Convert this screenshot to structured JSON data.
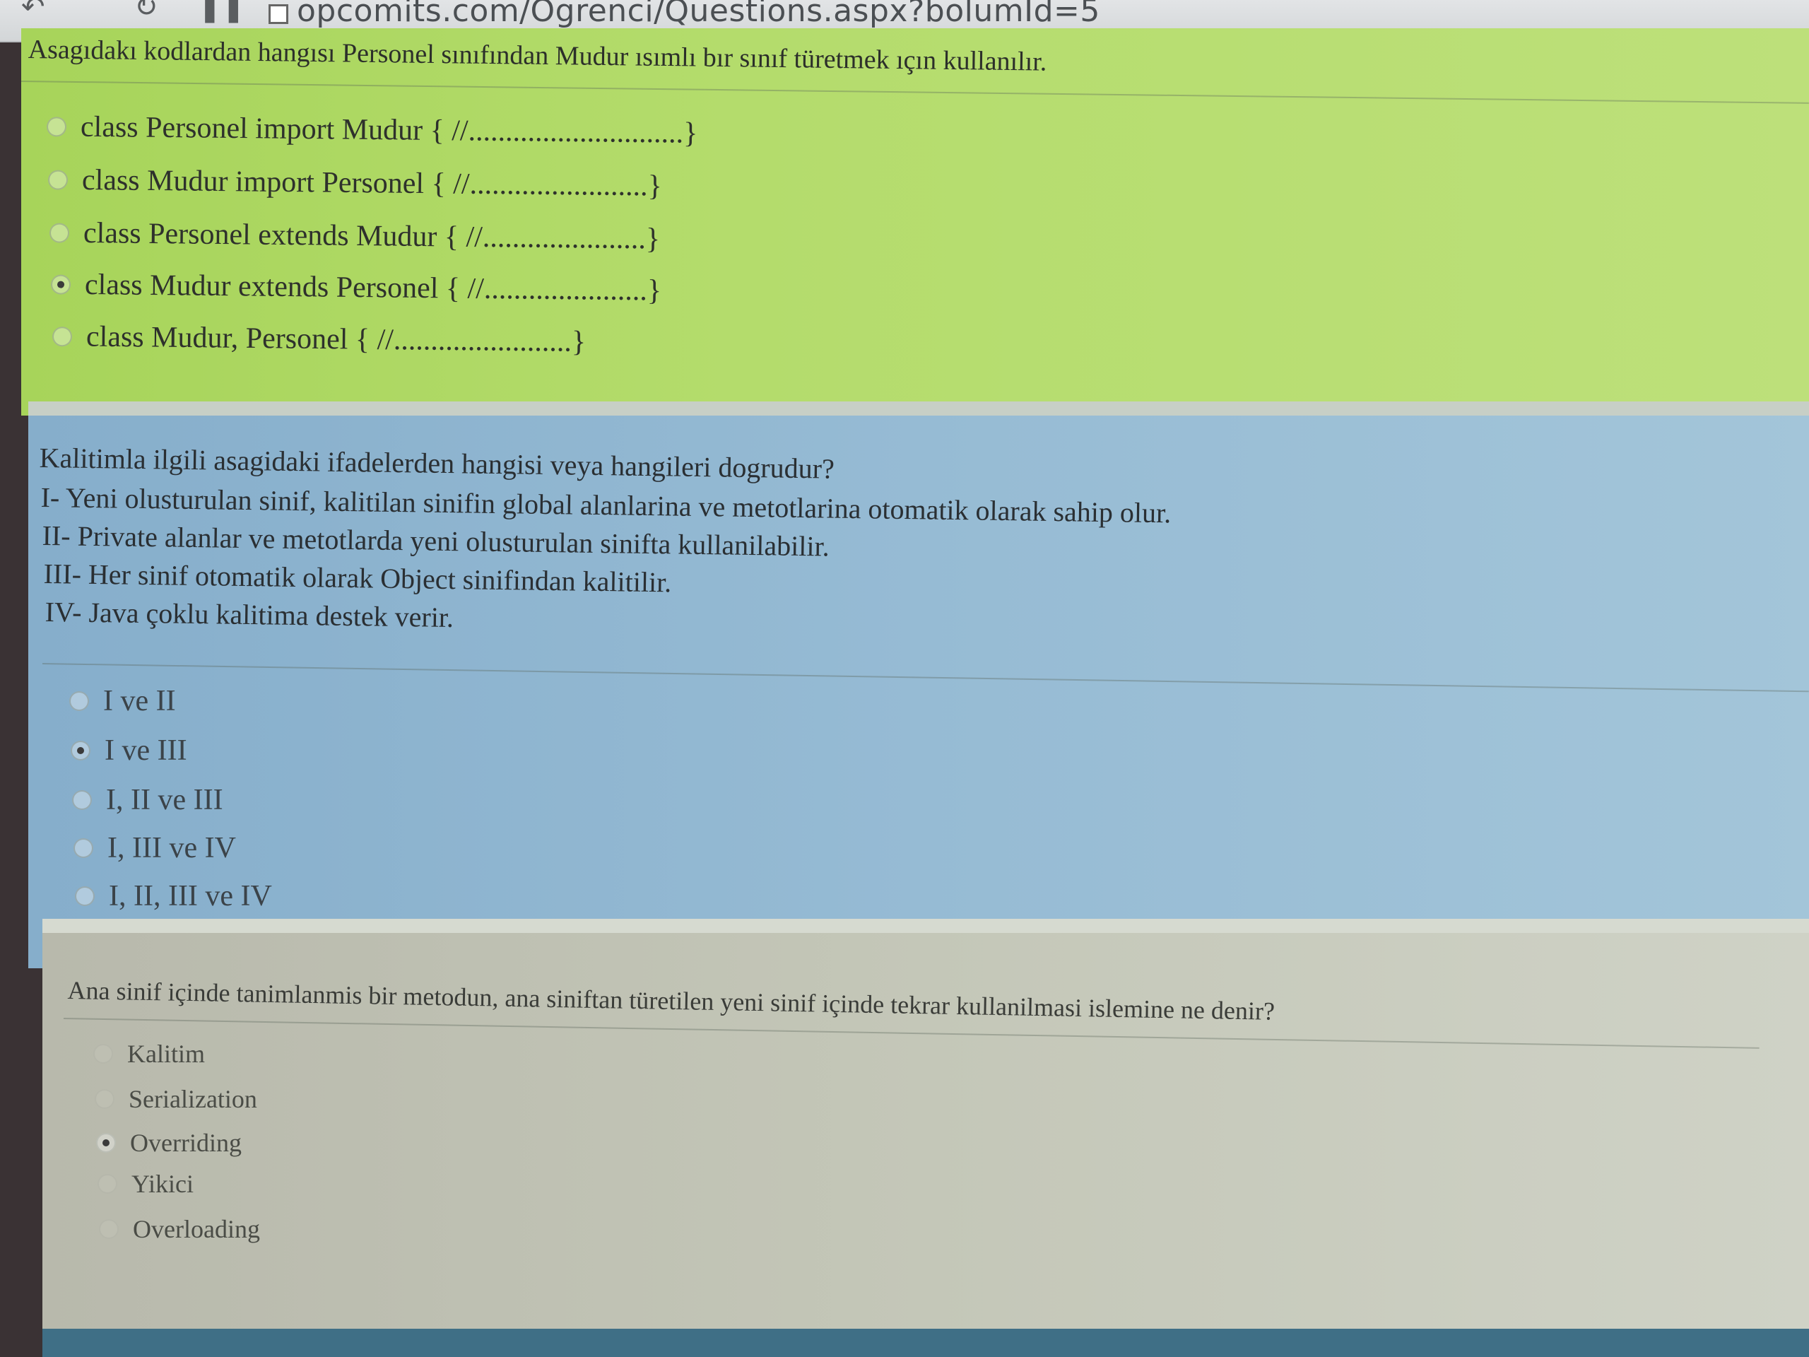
{
  "browser": {
    "url": "opcomits.com/Ogrenci/Questions.aspx?bolumId=5"
  },
  "question1": {
    "text": "Asagıdakı kodlardan hangısı Personel sınıfından Mudur ısımlı bır sınıf türetmek ıçın kullanılır.",
    "options": [
      {
        "label": "class Personel import Mudur { //.............................}",
        "selected": false
      },
      {
        "label": "class Mudur import Personel { //........................}",
        "selected": false
      },
      {
        "label": "class Personel extends Mudur { //......................}",
        "selected": false
      },
      {
        "label": "class Mudur extends Personel { //......................}",
        "selected": true
      },
      {
        "label": "class Mudur, Personel { //........................}",
        "selected": false
      }
    ]
  },
  "question2": {
    "text": "Kalitimla ilgili asagidaki ifadelerden hangisi veya hangileri dogrudur?",
    "statements": [
      "I- Yeni olusturulan sinif, kalitilan sinifin global alanlarina ve metotlarina otomatik olarak sahip olur.",
      "II- Private alanlar ve metotlarda yeni olusturulan sinifta kullanilabilir.",
      "III- Her sinif otomatik olarak Object sinifindan kalitilir.",
      "IV- Java çoklu kalitima destek verir."
    ],
    "options": [
      {
        "label": "I ve II",
        "selected": false
      },
      {
        "label": "I ve III",
        "selected": true
      },
      {
        "label": "I, II ve III",
        "selected": false
      },
      {
        "label": "I, III ve IV",
        "selected": false
      },
      {
        "label": "I, II, III ve IV",
        "selected": false
      }
    ]
  },
  "question3": {
    "text": "Ana sinif içinde tanimlanmis bir metodun, ana siniftan türetilen yeni sinif içinde tekrar kullanilmasi islemine ne denir?",
    "options": [
      {
        "label": "Kalitim",
        "selected": false
      },
      {
        "label": "Serialization",
        "selected": false
      },
      {
        "label": "Overriding",
        "selected": true
      },
      {
        "label": "Yikici",
        "selected": false
      },
      {
        "label": "Overloading",
        "selected": false
      }
    ]
  },
  "icons": {
    "back": "back-arrow-icon",
    "reload": "reload-icon",
    "page": "page-icon"
  }
}
